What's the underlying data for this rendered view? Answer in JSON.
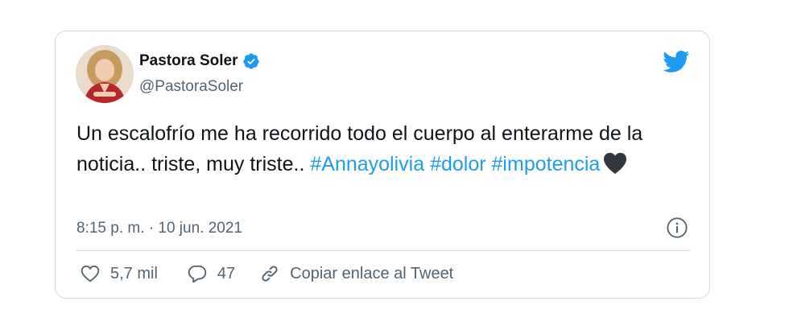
{
  "author": {
    "name": "Pastora Soler",
    "handle": "@PastoraSoler",
    "verified": true
  },
  "tweet": {
    "text_plain": "Un escalofrío me ha recorrido todo el cuerpo al enterarme de la noticia.. triste, muy triste.. ",
    "hashtag_1": "#Annayolivia",
    "hashtag_2": "#dolor",
    "hashtag_3": "#impotencia",
    "emoji": "black-heart"
  },
  "timestamp": "8:15 p. m. · 10 jun. 2021",
  "actions": {
    "likes": "5,7 mil",
    "replies": "47",
    "copy_link_label": "Copiar enlace al Tweet"
  },
  "colors": {
    "accent": "#1d9bf0",
    "text": "#0f1419",
    "secondary": "#536471",
    "border": "#cfd9de"
  }
}
